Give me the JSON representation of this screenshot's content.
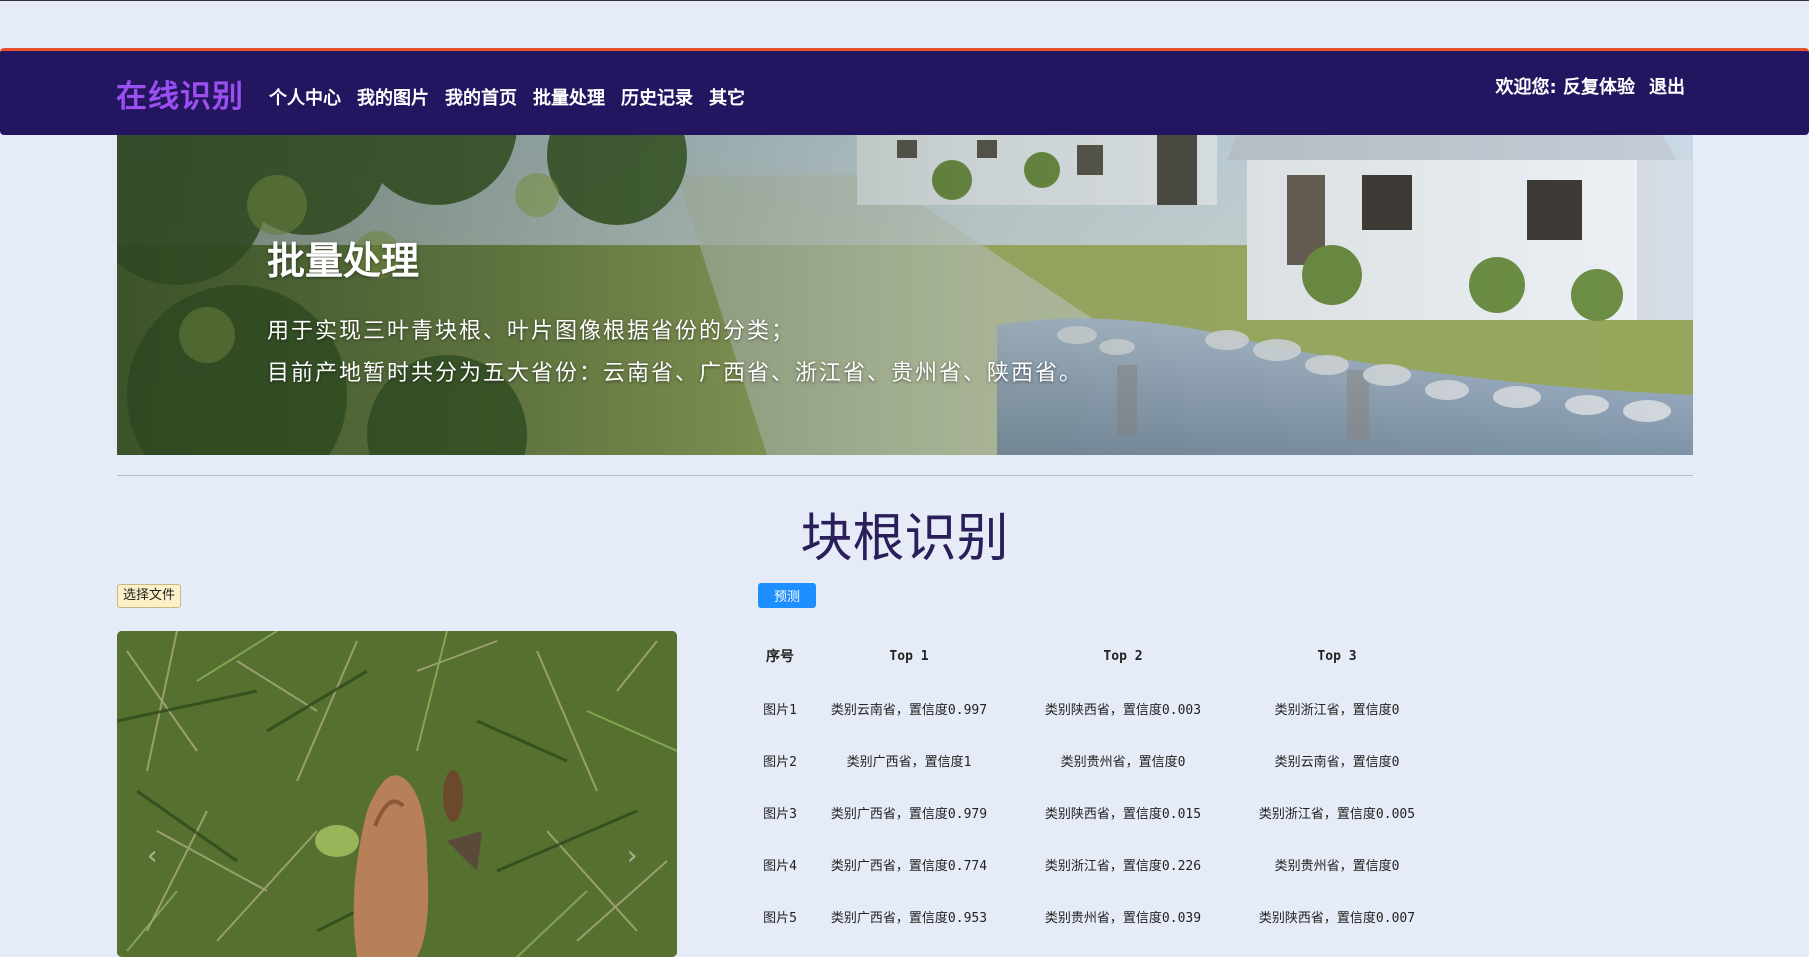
{
  "navbar": {
    "brand": "在线识别",
    "links": [
      "个人中心",
      "我的图片",
      "我的首页",
      "批量处理",
      "历史记录",
      "其它"
    ],
    "welcome": "欢迎您: 反复体验",
    "logout": "退出"
  },
  "banner": {
    "title": "批量处理",
    "line1": "用于实现三叶青块根、叶片图像根据省份的分类；",
    "line2": "目前产地暂时共分为五大省份：云南省、广西省、浙江省、贵州省、陕西省。"
  },
  "section": {
    "title": "块根识别",
    "file_button": "选择文件",
    "predict_button": "预测"
  },
  "carousel": {
    "prev_icon": "chevron-left-icon",
    "next_icon": "chevron-right-icon"
  },
  "results": {
    "headers": [
      "序号",
      "Top 1",
      "Top 2",
      "Top 3"
    ],
    "rows": [
      [
        "图片1",
        "类别云南省，置信度0.997",
        "类别陕西省，置信度0.003",
        "类别浙江省，置信度0"
      ],
      [
        "图片2",
        "类别广西省，置信度1",
        "类别贵州省，置信度0",
        "类别云南省，置信度0"
      ],
      [
        "图片3",
        "类别广西省，置信度0.979",
        "类别陕西省，置信度0.015",
        "类别浙江省，置信度0.005"
      ],
      [
        "图片4",
        "类别广西省，置信度0.774",
        "类别浙江省，置信度0.226",
        "类别贵州省，置信度0"
      ],
      [
        "图片5",
        "类别广西省，置信度0.953",
        "类别贵州省，置信度0.039",
        "类别陕西省，置信度0.007"
      ]
    ]
  },
  "colors": {
    "navbar_bg": "#23155f",
    "navbar_accent": "#e5532e",
    "brand": "#9b4ff0",
    "predict_button": "#1e8fff",
    "page_bg": "#e6ecf7"
  }
}
